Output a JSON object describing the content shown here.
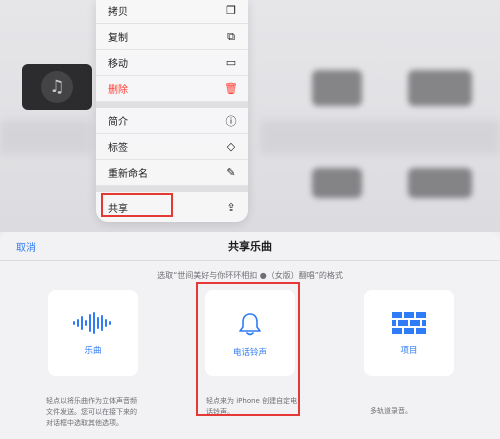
{
  "context_menu": {
    "items": [
      {
        "label": "拷贝",
        "icon": "copy-icon",
        "glyph": "❐"
      },
      {
        "label": "复制",
        "icon": "duplicate-icon",
        "glyph": "⧉"
      },
      {
        "label": "移动",
        "icon": "folder-icon",
        "glyph": "▭"
      },
      {
        "label": "删除",
        "icon": "trash-icon",
        "glyph": "🗑"
      },
      {
        "label": "简介",
        "icon": "info-icon",
        "glyph": "ⓘ"
      },
      {
        "label": "标签",
        "icon": "tag-icon",
        "glyph": "◇"
      },
      {
        "label": "重新命名",
        "icon": "pencil-icon",
        "glyph": "✎"
      },
      {
        "label": "共享",
        "icon": "share-icon",
        "glyph": "⇪"
      }
    ]
  },
  "share_sheet": {
    "cancel_label": "取消",
    "title": "共享乐曲",
    "subtitle": "选取“世间美好与你环环相扣 ●（女版）翻唱”的格式",
    "options": [
      {
        "label": "乐曲",
        "icon": "waveform-icon",
        "description": "轻点以将乐曲作为立体声音频文件发送。您可以在接下来的对话框中选取其他选项。"
      },
      {
        "label": "电话铃声",
        "icon": "bell-icon",
        "description": "轻点来为 iPhone 创建自定电话铃声。"
      },
      {
        "label": "项目",
        "icon": "brick-wall-icon",
        "description": "多轨道录音。"
      }
    ]
  },
  "colors": {
    "accent": "#2f7cf6",
    "destructive": "#ff3b30",
    "highlight": "#e53935"
  }
}
